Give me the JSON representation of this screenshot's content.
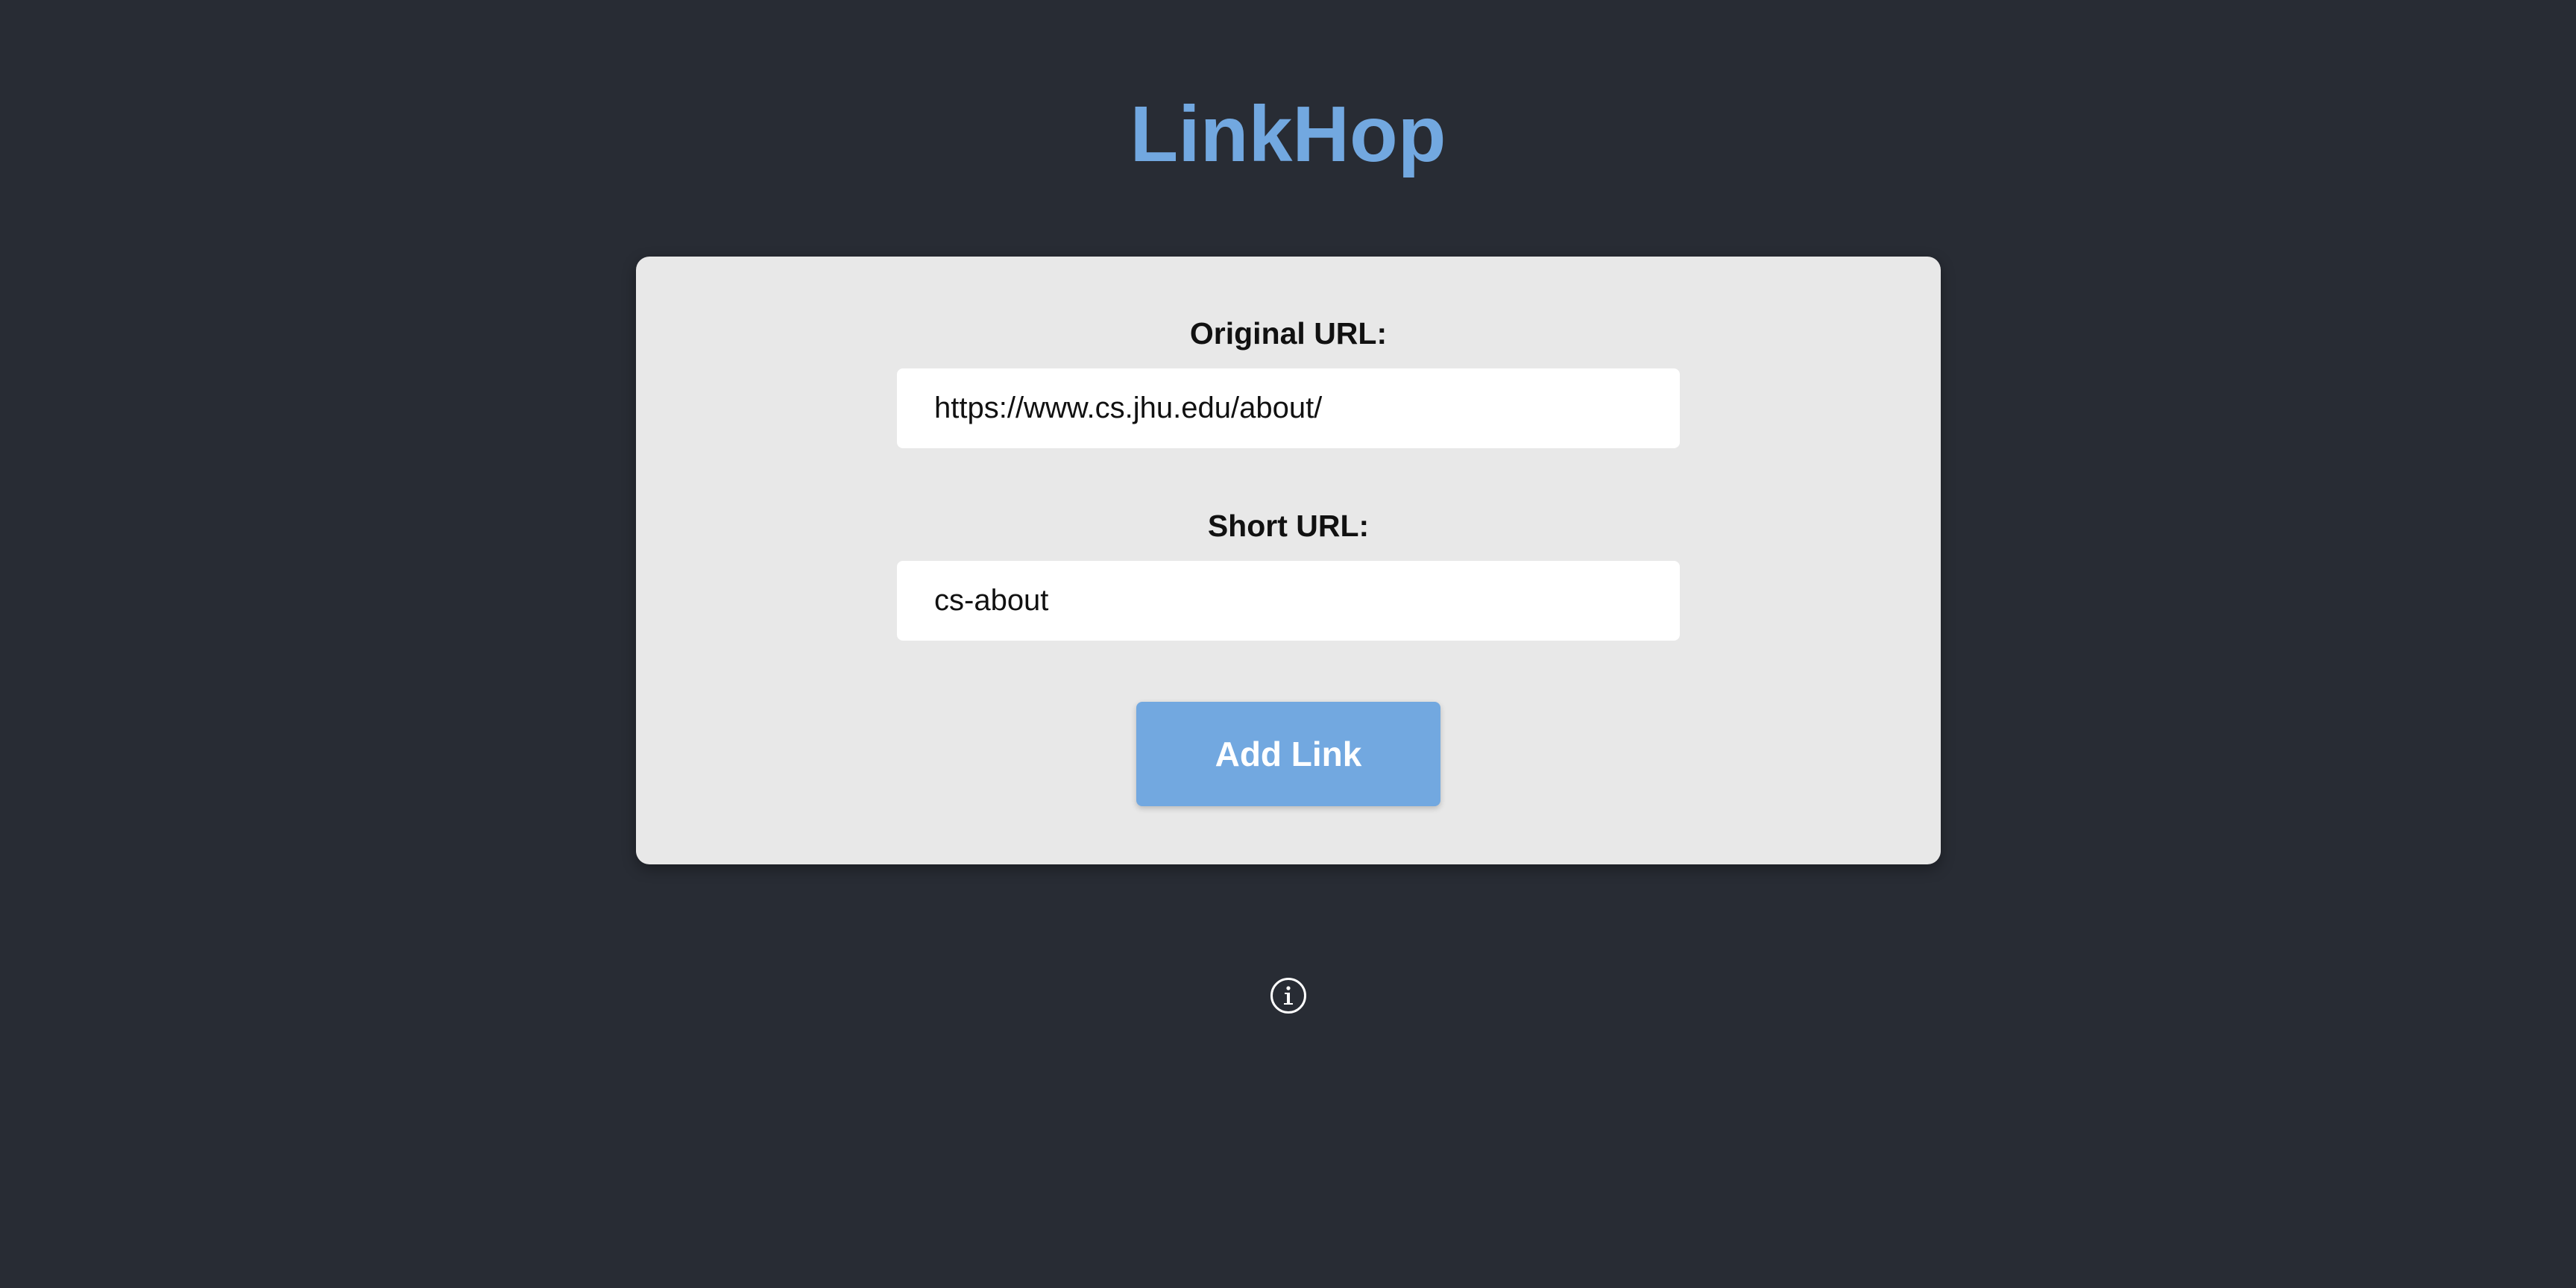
{
  "app": {
    "title": "LinkHop"
  },
  "form": {
    "original_url_label": "Original URL:",
    "original_url_value": "https://www.cs.jhu.edu/about/",
    "short_url_label": "Short URL:",
    "short_url_value": "cs-about",
    "submit_label": "Add Link"
  },
  "footer": {
    "info_icon": "info-icon"
  },
  "colors": {
    "background": "#282c34",
    "accent": "#72a8e0",
    "card": "#e8e8e8"
  }
}
